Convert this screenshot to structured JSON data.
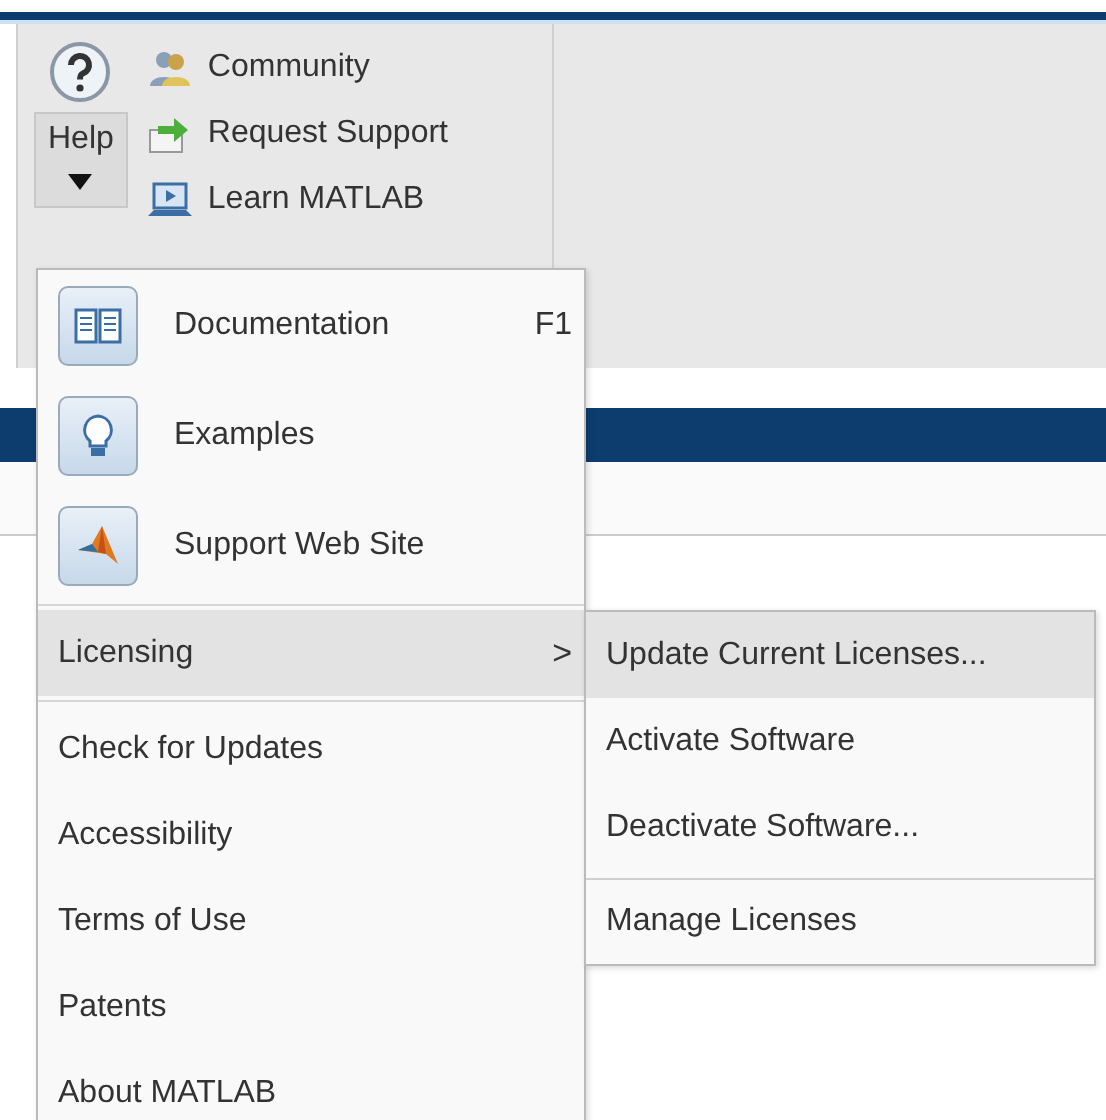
{
  "ribbon": {
    "help_button": {
      "label": "Help"
    },
    "small_buttons": [
      {
        "label": "Community"
      },
      {
        "label": "Request Support"
      },
      {
        "label": "Learn MATLAB"
      }
    ]
  },
  "menu": {
    "large_items": [
      {
        "label": "Documentation",
        "shortcut": "F1"
      },
      {
        "label": "Examples"
      },
      {
        "label": "Support Web Site"
      }
    ],
    "items": [
      {
        "label": "Licensing",
        "arrow": ">",
        "selected": true
      },
      {
        "label": "Check for Updates",
        "selected": false
      },
      {
        "label": "Accessibility",
        "selected": false
      },
      {
        "label": "Terms of Use",
        "selected": false
      },
      {
        "label": "Patents",
        "selected": false
      },
      {
        "label": "About MATLAB",
        "selected": false
      }
    ]
  },
  "submenu": {
    "items": [
      {
        "label": "Update Current Licenses...",
        "selected": true,
        "separator_before": false
      },
      {
        "label": "Activate Software",
        "selected": false,
        "separator_before": false
      },
      {
        "label": "Deactivate Software...",
        "selected": false,
        "separator_before": false
      },
      {
        "label": "Manage Licenses",
        "selected": false,
        "separator_before": true
      }
    ]
  }
}
